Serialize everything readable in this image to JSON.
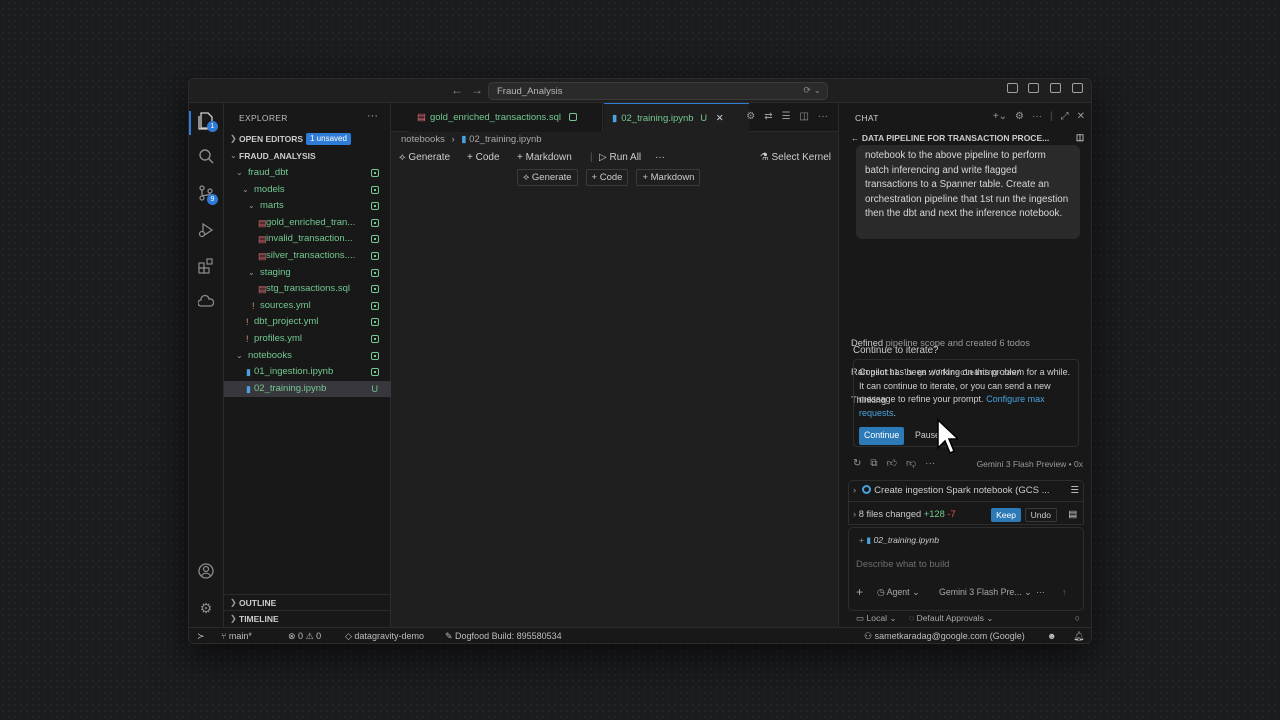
{
  "titlebar": {
    "command_center": "Fraud_Analysis"
  },
  "explorer": {
    "title": "EXPLORER",
    "open_editors": "OPEN EDITORS",
    "unsaved_badge": "1 unsaved",
    "root": "FRAUD_ANALYSIS",
    "tree": [
      {
        "label": "fraud_dbt",
        "indent": 1,
        "kind": "folder"
      },
      {
        "label": "models",
        "indent": 2,
        "kind": "folder"
      },
      {
        "label": "marts",
        "indent": 3,
        "kind": "folder"
      },
      {
        "label": "gold_enriched_tran...",
        "indent": 4,
        "kind": "sql"
      },
      {
        "label": "invalid_transaction...",
        "indent": 4,
        "kind": "sql"
      },
      {
        "label": "silver_transactions....",
        "indent": 4,
        "kind": "sql"
      },
      {
        "label": "staging",
        "indent": 3,
        "kind": "folder"
      },
      {
        "label": "stg_transactions.sql",
        "indent": 4,
        "kind": "sql"
      },
      {
        "label": "sources.yml",
        "indent": 3,
        "kind": "yml"
      },
      {
        "label": "dbt_project.yml",
        "indent": 2,
        "kind": "yml"
      },
      {
        "label": "profiles.yml",
        "indent": 2,
        "kind": "yml"
      },
      {
        "label": "notebooks",
        "indent": 1,
        "kind": "folder"
      },
      {
        "label": "01_ingestion.ipynb",
        "indent": 2,
        "kind": "nb"
      },
      {
        "label": "02_training.ipynb",
        "indent": 2,
        "kind": "nb",
        "status": "U"
      }
    ],
    "outline": "OUTLINE",
    "timeline": "TIMELINE"
  },
  "editor": {
    "tabs": [
      {
        "label": "gold_enriched_transactions.sql"
      },
      {
        "label": "02_training.ipynb",
        "status": "U"
      }
    ],
    "breadcrumb": [
      "notebooks",
      "02_training.ipynb"
    ],
    "toolbar": {
      "generate": "Generate",
      "code": "Code",
      "markdown": "Markdown",
      "run_all": "Run All",
      "more": "···",
      "select_kernel": "Select Kernel"
    },
    "cell_actions": [
      "Generate",
      "Code",
      "Markdown"
    ]
  },
  "chat": {
    "title": "CHAT",
    "session_title": "DATA PIPELINE FOR TRANSACTION PROCE...",
    "user_message": "notebook to the above pipeline to perform batch inferencing and write flagged transactions to a Spanner table. Create an orchestration pipeline that 1st run the ingestion then the dbt and next the inference notebook.",
    "progress": {
      "defined_verb": "Defined",
      "defined_rest": "pipeline scope and created 6 todos",
      "ran_verb": "Ran",
      "ran_cmd": "gsutil ls gs://fin-clearing-raw/",
      "thinking": "Thinking"
    },
    "iterate": {
      "title": "Continue to iterate?",
      "body": "Copilot has been working on this problem for a while. It can continue to iterate, or you can send a new message to refine your prompt.",
      "link": "Configure max requests",
      "continue": "Continue",
      "pause": "Pause"
    },
    "model_note": "Gemini 3 Flash Preview • 0x",
    "task": "Create ingestion Spark notebook (GCS ...",
    "changes": {
      "label": "8 files changed",
      "added": "+128",
      "removed": "-7",
      "keep": "Keep",
      "undo": "Undo"
    },
    "attached_file": "02_training.ipynb",
    "input_placeholder": "Describe what to build",
    "mode": "Agent",
    "model": "Gemini 3 Flash Pre...",
    "location": "Local",
    "approvals": "Default Approvals"
  },
  "statusbar": {
    "branch": "main*",
    "errors": "0",
    "warnings": "0",
    "project": "datagravity-demo",
    "build": "Dogfood Build: 895580534",
    "account": "sametkaradag@google.com (Google)"
  },
  "colors": {
    "accent": "#2f7bd8",
    "git_untracked": "#73c991",
    "sql_file": "#e06c75"
  }
}
